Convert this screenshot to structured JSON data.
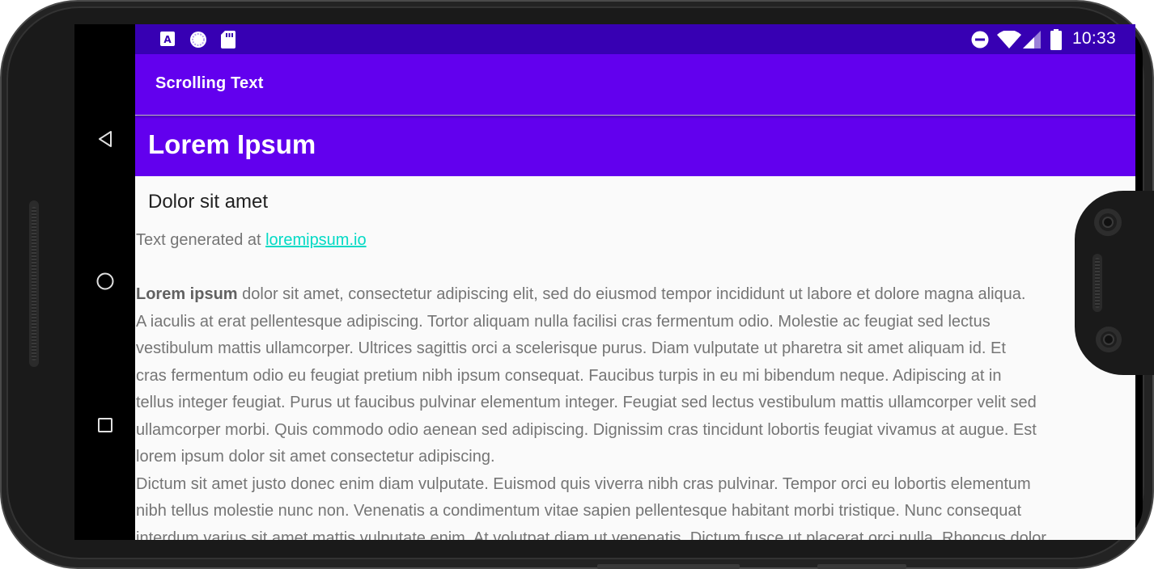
{
  "status_bar": {
    "time": "10:33",
    "notification_icons": [
      "text-input-a-icon",
      "sync-circle-icon",
      "sd-card-icon"
    ],
    "system_icons": [
      "do-not-disturb-icon",
      "wifi-icon",
      "cellular-signal-icon",
      "battery-icon"
    ]
  },
  "nav_bar": {
    "buttons": [
      "back-icon",
      "home-icon",
      "recents-icon"
    ]
  },
  "app_bar": {
    "title": "Scrolling Text"
  },
  "content": {
    "heading": "Lorem Ipsum",
    "subheading": "Dolor sit amet",
    "credit_prefix": "Text generated at ",
    "credit_link": "loremipsum.io",
    "article_bold": "Lorem ipsum",
    "article_lines": [
      " dolor sit amet, consectetur adipiscing elit, sed do eiusmod tempor incididunt ut labore et dolore magna aliqua.",
      "A iaculis at erat pellentesque adipiscing. Tortor aliquam nulla facilisi cras fermentum odio. Molestie ac feugiat sed lectus",
      "vestibulum mattis ullamcorper. Ultrices sagittis orci a scelerisque purus. Diam vulputate ut pharetra sit amet aliquam id. Et",
      "cras fermentum odio eu feugiat pretium nibh ipsum consequat. Faucibus turpis in eu mi bibendum neque. Adipiscing at in",
      "tellus integer feugiat. Purus ut faucibus pulvinar elementum integer. Feugiat sed lectus vestibulum mattis ullamcorper velit sed",
      "ullamcorper morbi. Quis commodo odio aenean sed adipiscing. Dignissim cras tincidunt lobortis feugiat vivamus at augue. Est",
      "lorem ipsum dolor sit amet consectetur adipiscing.",
      "Dictum sit amet justo donec enim diam vulputate. Euismod quis viverra nibh cras pulvinar. Tempor orci eu lobortis elementum",
      "nibh tellus molestie nunc non. Venenatis a condimentum vitae sapien pellentesque habitant morbi tristique. Nunc consequat",
      "interdum varius sit amet mattis vulputate enim. At volutpat diam ut venenatis. Dictum fusce ut placerat orci nulla. Rhoncus dolor"
    ]
  },
  "colors": {
    "status_bar": "#3700b3",
    "primary": "#6200ee",
    "link": "#03dac5",
    "body_text": "#757575"
  }
}
